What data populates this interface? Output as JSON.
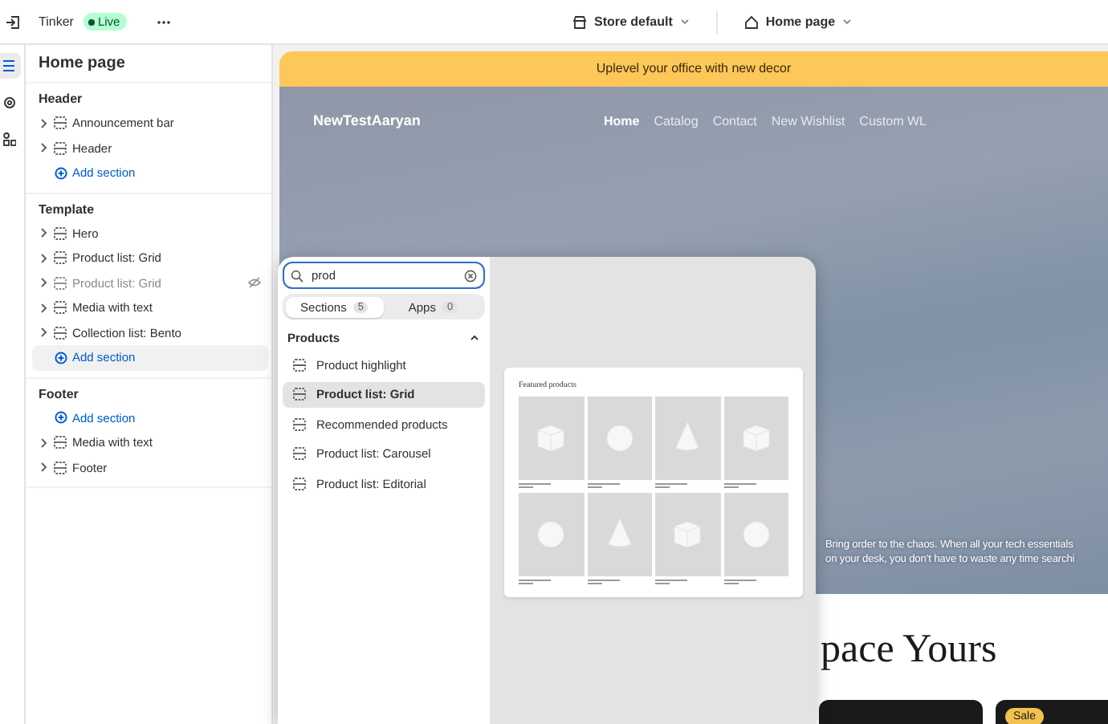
{
  "topbar": {
    "theme_name": "Tinker",
    "status": "Live",
    "store": "Store default",
    "page": "Home page"
  },
  "rail": [
    {
      "kind": "sections",
      "selected": true
    },
    {
      "kind": "settings",
      "selected": false
    },
    {
      "kind": "apps",
      "selected": false
    }
  ],
  "sidebar": {
    "title": "Home page",
    "groups": [
      {
        "title": "Header",
        "items": [
          {
            "kind": "section",
            "label": "Announcement bar",
            "hidden": false,
            "selected": false
          },
          {
            "kind": "section",
            "label": "Header",
            "hidden": false,
            "selected": false
          },
          {
            "kind": "add",
            "label": "Add section",
            "selected": false
          }
        ]
      },
      {
        "title": "Template",
        "items": [
          {
            "kind": "section",
            "label": "Hero",
            "hidden": false,
            "selected": false
          },
          {
            "kind": "section",
            "label": "Product list: Grid",
            "hidden": false,
            "selected": false
          },
          {
            "kind": "section",
            "label": "Product list: Grid",
            "hidden": true,
            "selected": false
          },
          {
            "kind": "section",
            "label": "Media with text",
            "hidden": false,
            "selected": false
          },
          {
            "kind": "section",
            "label": "Collection list: Bento",
            "hidden": false,
            "selected": false
          },
          {
            "kind": "add",
            "label": "Add section",
            "selected": true
          }
        ]
      },
      {
        "title": "Footer",
        "items": [
          {
            "kind": "add",
            "label": "Add section",
            "selected": false
          },
          {
            "kind": "section",
            "label": "Media with text",
            "hidden": false,
            "selected": false
          },
          {
            "kind": "section",
            "label": "Footer",
            "hidden": false,
            "selected": false
          }
        ]
      }
    ]
  },
  "preview": {
    "announcement": "Uplevel your office with new decor",
    "brand": "NewTestAaryan",
    "nav": [
      {
        "label": "Home",
        "selected": true
      },
      {
        "label": "Catalog",
        "selected": false
      },
      {
        "label": "Contact",
        "selected": false
      },
      {
        "label": "New Wishlist",
        "selected": false
      },
      {
        "label": "Custom WL",
        "selected": false
      }
    ],
    "hero_text": [
      "Bring order to the chaos. When all your tech essentials",
      "on your desk, you don’t have to waste any time searchi"
    ],
    "heading": "pace Yours",
    "product_cards": [
      {
        "kind": "plain"
      },
      {
        "kind": "sale",
        "badge": "Sale"
      }
    ]
  },
  "picker": {
    "search": {
      "value": "prod"
    },
    "tabs": [
      {
        "label": "Sections",
        "count": "5",
        "selected": true
      },
      {
        "label": "Apps",
        "count": "0",
        "selected": false
      }
    ],
    "group": {
      "title": "Products",
      "expanded": true
    },
    "items": [
      {
        "label": "Product highlight",
        "selected": false
      },
      {
        "label": "Product list: Grid",
        "selected": true
      },
      {
        "label": "Recommended products",
        "selected": false
      },
      {
        "label": "Product list: Carousel",
        "selected": false
      },
      {
        "label": "Product list: Editorial",
        "selected": false
      }
    ],
    "preview": {
      "title": "Featured products",
      "tiles": [
        {
          "kind": "cube"
        },
        {
          "kind": "sphere"
        },
        {
          "kind": "cone"
        },
        {
          "kind": "cube"
        },
        {
          "kind": "sphere"
        },
        {
          "kind": "cone"
        },
        {
          "kind": "cube"
        },
        {
          "kind": "sphere"
        }
      ]
    }
  }
}
